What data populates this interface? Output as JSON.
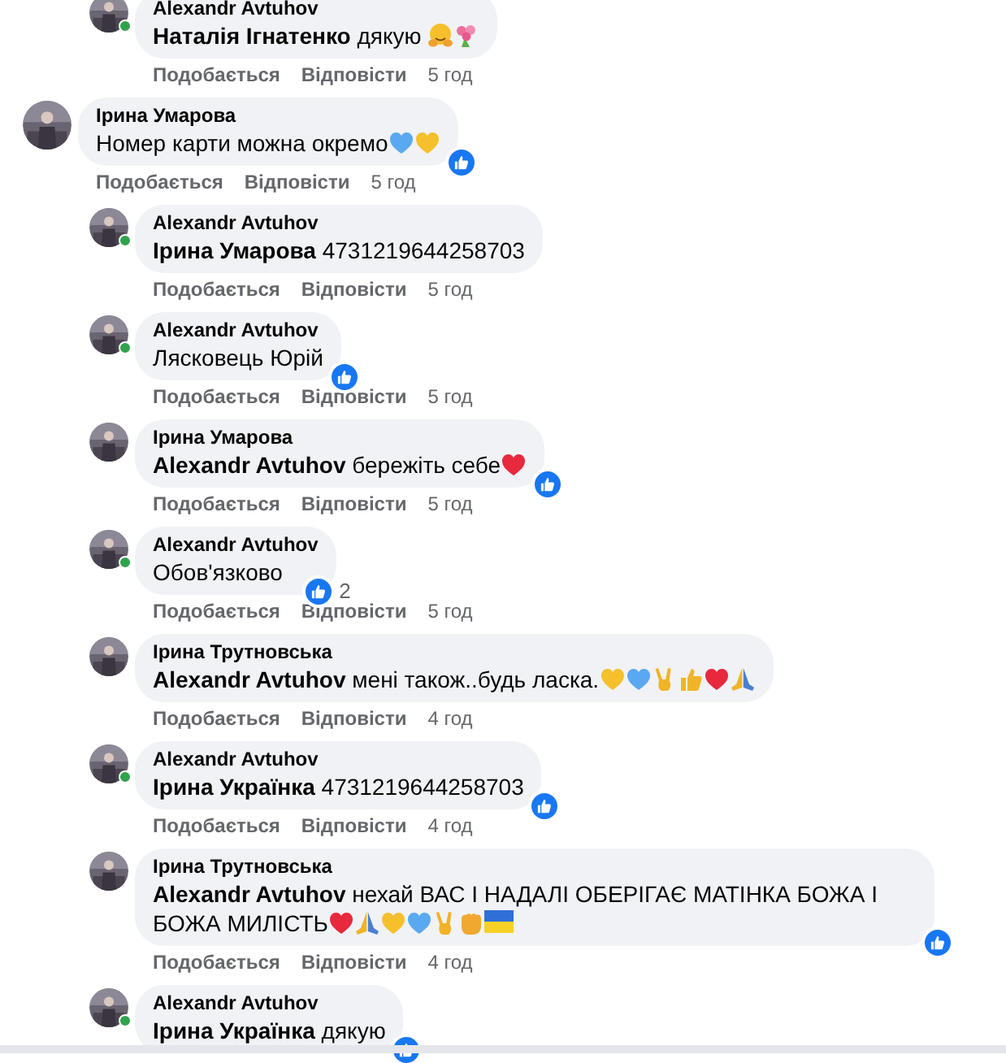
{
  "earlier_replies": [
    {
      "author": "Alexandr Avtuhov",
      "online": true,
      "text": "**Наталія Ігнатенко** дякую ",
      "emojis": [
        {
          "kind": "hug"
        },
        {
          "kind": "bouquet"
        }
      ],
      "liked": false,
      "like": "Подобається",
      "reply": "Відповісти",
      "time": "5 год"
    }
  ],
  "comments": [
    {
      "author": "Ірина Умарова",
      "online": false,
      "text": "Номер карти можна окремо",
      "emojis": [
        {
          "kind": "heart",
          "color": "#5aa9f0"
        },
        {
          "kind": "heart",
          "color": "#f5c02c"
        }
      ],
      "liked": true,
      "like": "Подобається",
      "reply": "Відповісти",
      "time": "5 год",
      "children": [
        {
          "author": "Alexandr Avtuhov",
          "online": true,
          "text": "**Ірина Умарова** 4731219644258703",
          "liked": false,
          "like": "Подобається",
          "reply": "Відповісти",
          "time": "5 год"
        },
        {
          "author": "Alexandr Avtuhov",
          "online": true,
          "text": "Лясковець Юрій",
          "liked": true,
          "like": "Подобається",
          "reply": "Відповісти",
          "time": "5 год"
        },
        {
          "author": "Ірина Умарова",
          "online": false,
          "text": "**Alexandr Avtuhov** бережіть себе",
          "emojis": [
            {
              "kind": "heart",
              "color": "#e8283c"
            }
          ],
          "liked": true,
          "like": "Подобається",
          "reply": "Відповісти",
          "time": "5 год"
        },
        {
          "author": "Alexandr Avtuhov",
          "online": true,
          "text": "Обов'язково",
          "liked": true,
          "reaction_count": "2",
          "like": "Подобається",
          "reply": "Відповісти",
          "time": "5 год"
        },
        {
          "author": "Ірина Трутновська",
          "online": false,
          "text": "**Alexandr Avtuhov** мені також..будь ласка.",
          "emojis": [
            {
              "kind": "heart",
              "color": "#f5c02c"
            },
            {
              "kind": "heart",
              "color": "#5aa9f0"
            },
            {
              "kind": "victory"
            },
            {
              "kind": "thumb"
            },
            {
              "kind": "heart",
              "color": "#e8283c"
            },
            {
              "kind": "pray"
            }
          ],
          "liked": false,
          "like": "Подобається",
          "reply": "Відповісти",
          "time": "4 год"
        },
        {
          "author": "Alexandr Avtuhov",
          "online": true,
          "text": "**Ірина Українка** 4731219644258703",
          "liked": true,
          "like": "Подобається",
          "reply": "Відповісти",
          "time": "4 год"
        },
        {
          "author": "Ірина Трутновська",
          "online": false,
          "text": "**Alexandr Avtuhov** нехай ВАС І НАДАЛІ ОБЕРІГАЄ МАТІНКА БОЖА І БОЖА МИЛІСТЬ",
          "emojis": [
            {
              "kind": "heart",
              "color": "#e8283c"
            },
            {
              "kind": "pray"
            },
            {
              "kind": "heart",
              "color": "#f5c02c"
            },
            {
              "kind": "heart",
              "color": "#5aa9f0"
            },
            {
              "kind": "victory"
            },
            {
              "kind": "fist"
            },
            {
              "kind": "flag"
            }
          ],
          "liked": true,
          "like": "Подобається",
          "reply": "Відповісти",
          "time": "4 год"
        },
        {
          "author": "Alexandr Avtuhov",
          "online": true,
          "text": "**Ірина Українка** дякую",
          "liked": true
        }
      ]
    }
  ]
}
